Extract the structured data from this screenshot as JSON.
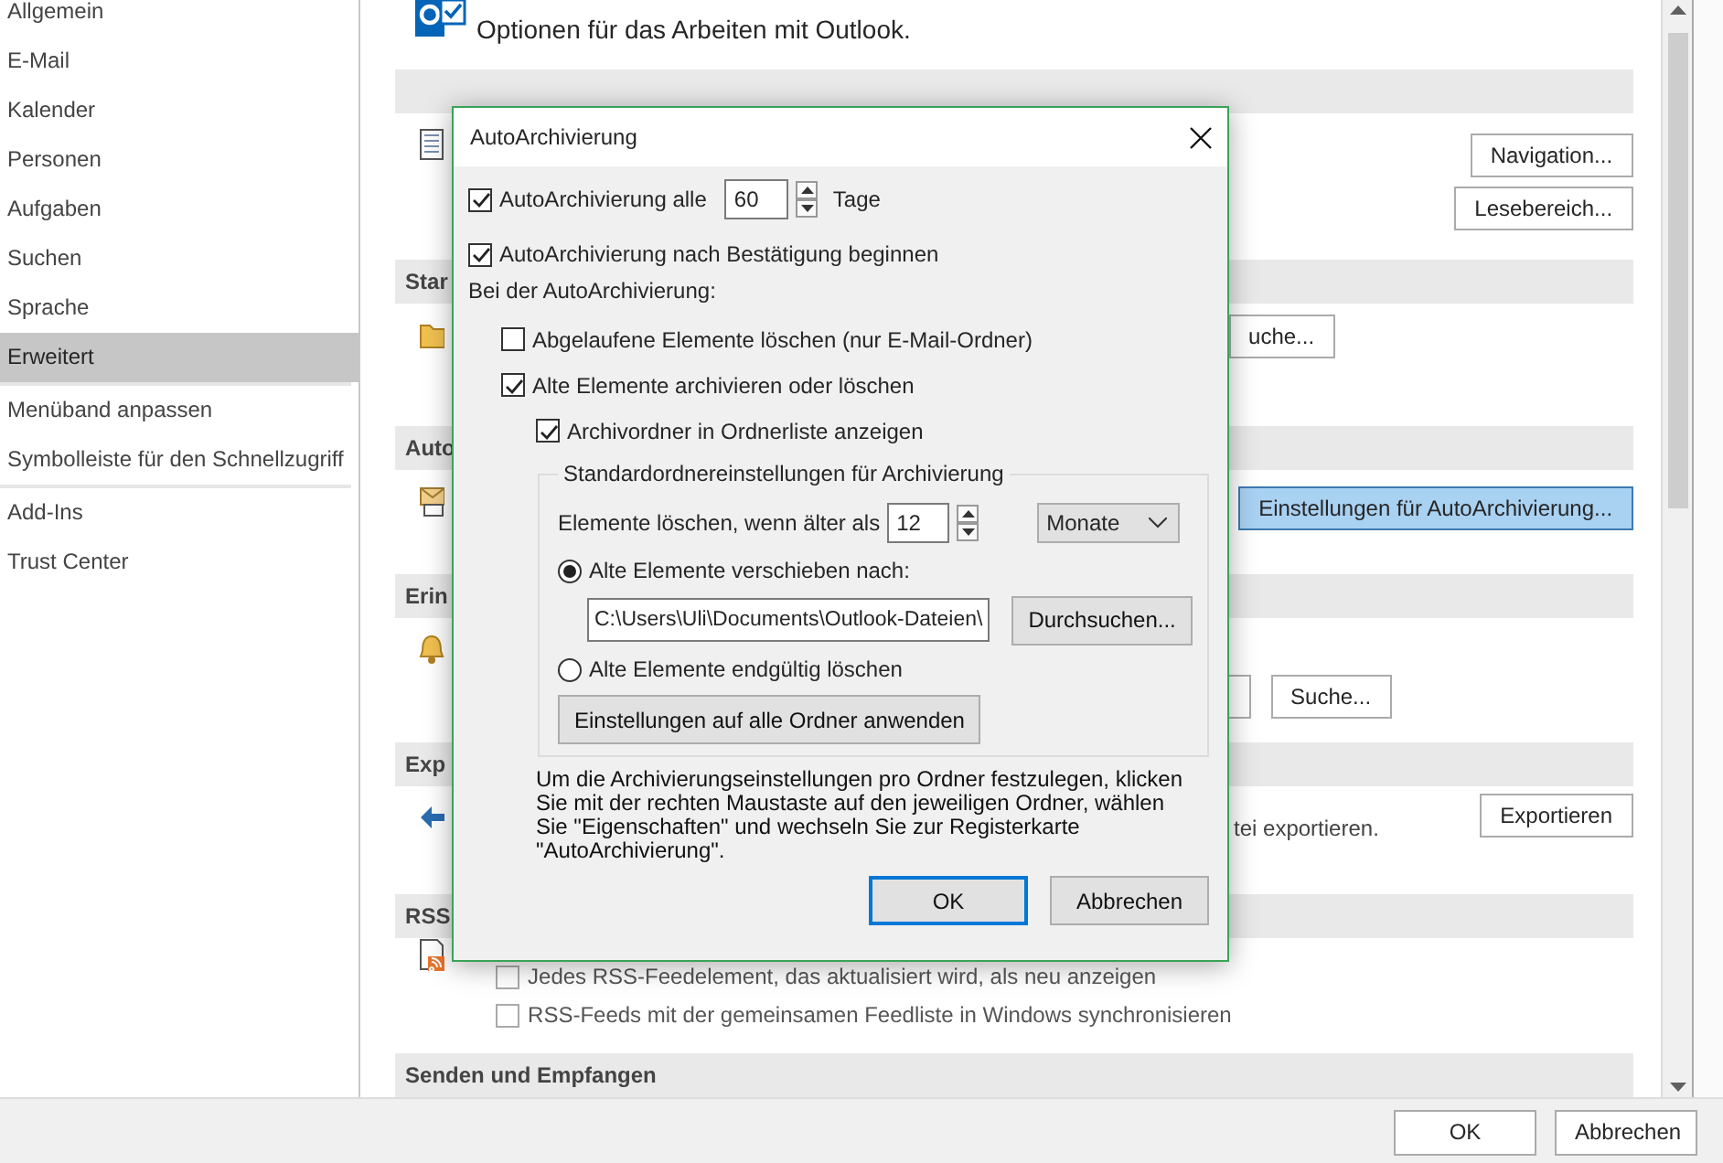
{
  "sidebar": {
    "items": [
      {
        "label": "Allgemein",
        "selected": false,
        "divider_after": false
      },
      {
        "label": "E-Mail",
        "selected": false,
        "divider_after": false
      },
      {
        "label": "Kalender",
        "selected": false,
        "divider_after": false
      },
      {
        "label": "Personen",
        "selected": false,
        "divider_after": false
      },
      {
        "label": "Aufgaben",
        "selected": false,
        "divider_after": false
      },
      {
        "label": "Suchen",
        "selected": false,
        "divider_after": false
      },
      {
        "label": "Sprache",
        "selected": false,
        "divider_after": false
      },
      {
        "label": "Erweitert",
        "selected": true,
        "divider_after": true
      },
      {
        "label": "Menüband anpassen",
        "selected": false,
        "divider_after": false
      },
      {
        "label": "Symbolleiste für den Schnellzugriff",
        "selected": false,
        "divider_after": true
      },
      {
        "label": "Add-Ins",
        "selected": false,
        "divider_after": false
      },
      {
        "label": "Trust Center",
        "selected": false,
        "divider_after": false
      }
    ]
  },
  "intro": "Optionen für das Arbeiten mit Outlook.",
  "sections": [
    {
      "items": [
        {
          "kind": "button",
          "label": "Navigation...",
          "highlighted": false
        },
        {
          "kind": "button",
          "label": "Lesebereich...",
          "highlighted": false
        }
      ]
    },
    {
      "heading": "Star",
      "items": [
        {
          "kind": "button",
          "label": "uche...",
          "highlighted": false
        }
      ]
    },
    {
      "heading": "Auto",
      "items": [
        {
          "kind": "button",
          "label": "Einstellungen für AutoArchivierung...",
          "highlighted": true
        }
      ]
    },
    {
      "heading": "Erin",
      "items": [
        {
          "kind": "field"
        },
        {
          "kind": "button",
          "label": "Suche...",
          "highlighted": false
        }
      ]
    },
    {
      "heading": "Exp",
      "items": [
        {
          "kind": "text",
          "label": "tei exportieren."
        },
        {
          "kind": "button",
          "label": "Exportieren",
          "highlighted": false
        }
      ]
    },
    {
      "heading": "RSS",
      "items": [
        {
          "kind": "checkbox",
          "label": "Jedes RSS-Feedelement, das aktualisiert wird, als neu anzeigen",
          "checked": false
        },
        {
          "kind": "checkbox",
          "label": "RSS-Feeds mit der gemeinsamen Feedliste in Windows synchronisieren",
          "checked": false
        }
      ]
    },
    {
      "heading": "Senden und Empfangen"
    }
  ],
  "footer": {
    "buttons": [
      "OK",
      "Abbrechen"
    ]
  },
  "dialog": {
    "title": "AutoArchivierung",
    "every": {
      "label": "AutoArchivierung alle",
      "checked": true,
      "value": "60",
      "unit": "Tage"
    },
    "prompt": {
      "label": "AutoArchivierung nach Bestätigung beginnen",
      "checked": true
    },
    "section_label": "Bei der AutoArchivierung:",
    "options": [
      {
        "label": "Abgelaufene Elemente löschen (nur E-Mail-Ordner)",
        "checked": false
      },
      {
        "label": "Alte Elemente archivieren oder löschen",
        "checked": true,
        "children": [
          {
            "label": "Archivordner in Ordnerliste anzeigen",
            "checked": true
          }
        ]
      }
    ],
    "group": {
      "legend": "Standardordnereinstellungen für Archivierung",
      "age_label": "Elemente löschen, wenn älter als",
      "age_value": "12",
      "age_unit": "Monate",
      "choices": [
        {
          "label": "Alte Elemente verschieben nach:",
          "selected": true,
          "path": "C:\\Users\\Uli\\Documents\\Outlook-Dateien\\",
          "browse": "Durchsuchen..."
        },
        {
          "label": "Alte Elemente endgültig löschen",
          "selected": false,
          "button": "Einstellungen auf alle Ordner anwenden"
        }
      ]
    },
    "note": "Um die Archivierungseinstellungen pro Ordner festzulegen, klicken\nSie mit der rechten Maustaste auf den jeweiligen Ordner, wählen\nSie \"Eigenschaften\" und wechseln Sie zur Registerkarte\n\"AutoArchivierung\".",
    "buttons": [
      {
        "label": "OK",
        "default": true
      },
      {
        "label": "Abbrechen",
        "default": false
      }
    ]
  }
}
